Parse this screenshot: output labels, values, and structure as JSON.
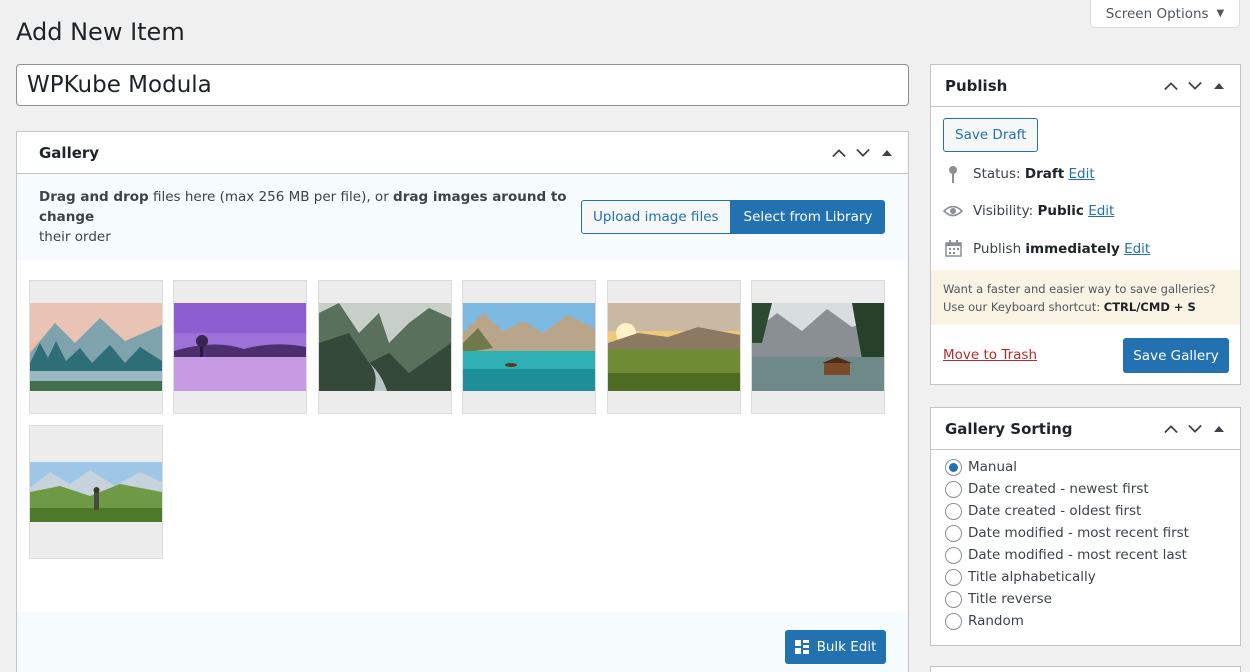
{
  "screen_options": {
    "label": "Screen Options"
  },
  "page": {
    "title": "Add New Item"
  },
  "title_field": {
    "value": "WPKube Modula"
  },
  "gallery": {
    "heading": "Gallery",
    "instructions_bold_1": "Drag and drop",
    "instructions_mid": " files here (max 256 MB per file), or ",
    "instructions_bold_2": "drag images around to change",
    "instructions_end": "their order",
    "upload_label": "Upload image files",
    "library_label": "Select from Library",
    "bulk_edit_label": "Bulk Edit",
    "images": [
      {
        "subject": "mountain lake at sunset with pine trees"
      },
      {
        "subject": "purple sky over calm lake with lone tree"
      },
      {
        "subject": "misty forest river valley"
      },
      {
        "subject": "turquoise alpine lake with rowboat"
      },
      {
        "subject": "sunrise over green meadow and mountains"
      },
      {
        "subject": "alpine lake with wooden boathouse"
      },
      {
        "subject": "hiker in green mountain valley"
      }
    ]
  },
  "publish": {
    "heading": "Publish",
    "save_draft_label": "Save Draft",
    "status_label": "Status:",
    "status_value": "Draft",
    "visibility_label": "Visibility:",
    "visibility_value": "Public",
    "publish_label": "Publish",
    "publish_value": "immediately",
    "edit_label": "Edit",
    "notice_text": "Want a faster and easier way to save galleries? Use our Keyboard shortcut: ",
    "notice_shortcut": "CTRL/CMD + S",
    "trash_label": "Move to Trash",
    "save_gallery_label": "Save Gallery"
  },
  "sorting": {
    "heading": "Gallery Sorting",
    "options": [
      {
        "label": "Manual",
        "checked": true
      },
      {
        "label": "Date created - newest first",
        "checked": false
      },
      {
        "label": "Date created - oldest first",
        "checked": false
      },
      {
        "label": "Date modified - most recent first",
        "checked": false
      },
      {
        "label": "Date modified - most recent last",
        "checked": false
      },
      {
        "label": "Title alphabetically",
        "checked": false
      },
      {
        "label": "Title reverse",
        "checked": false
      },
      {
        "label": "Random",
        "checked": false
      }
    ]
  },
  "colors": {
    "accent": "#2271b1",
    "danger": "#b32d2e",
    "notice_bg": "#f8f3e3"
  }
}
